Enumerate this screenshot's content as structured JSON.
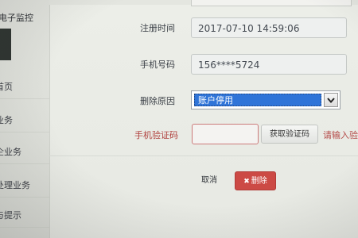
{
  "sidebar": {
    "title": "电子监控",
    "items": [
      {
        "label": "首页"
      },
      {
        "label": "业务"
      },
      {
        "label": "企业务"
      },
      {
        "label": "处理业务"
      },
      {
        "label": "与提示"
      }
    ]
  },
  "form": {
    "register_time": {
      "label": "注册时间",
      "value": "2017-07-10 14:59:06"
    },
    "phone": {
      "label": "手机号码",
      "value": "156****5724"
    },
    "delete_reason": {
      "label": "删除原因",
      "selected": "账户停用"
    },
    "captcha": {
      "label": "手机验证码",
      "value": "",
      "button_label": "获取验证码",
      "hint": "请输入验"
    }
  },
  "actions": {
    "cancel_label": "取消",
    "delete_icon": "x-icon",
    "delete_label": "删除"
  },
  "colors": {
    "delete_button": "#cc4a45",
    "select_highlight": "#2f74d8",
    "required_label": "#b0413e"
  }
}
